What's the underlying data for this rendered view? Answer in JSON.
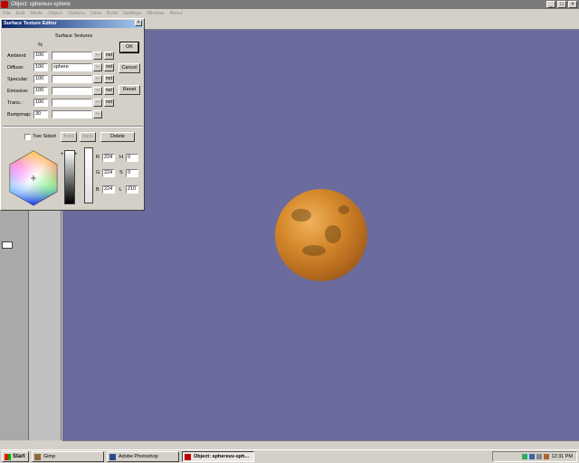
{
  "window": {
    "title": "Object: sphereuv-sphere"
  },
  "menubar": [
    "File",
    "Edit",
    "Mode",
    "Object",
    "Options",
    "View",
    "Build",
    "Settings",
    "Window",
    "About"
  ],
  "window_buttons": {
    "minimize": "_",
    "maximize": "□",
    "close": "×"
  },
  "dialog": {
    "title": "Surface Texture Editor",
    "close_glyph": "×",
    "section_label": "Surface Textures",
    "percent_header": "%",
    "rows": [
      {
        "label": "Ambient:",
        "value": "100",
        "texture": "",
        "browse": "...",
        "md": "md"
      },
      {
        "label": "Diffuse:",
        "value": "100",
        "texture": "sphere",
        "browse": "...",
        "md": "md"
      },
      {
        "label": "Specular:",
        "value": "100",
        "texture": "",
        "browse": "...",
        "md": "md"
      },
      {
        "label": "Emissive:",
        "value": "100",
        "texture": "",
        "browse": "...",
        "md": "md"
      },
      {
        "label": "Trans.:",
        "value": "100",
        "texture": "",
        "browse": "...",
        "md": "md"
      },
      {
        "label": "Bumpmap:",
        "value": "30",
        "texture": "",
        "browse": "...",
        "md": ""
      }
    ],
    "buttons": {
      "ok": "OK",
      "cancel": "Cancel",
      "reset": "Reset"
    },
    "two_sided": {
      "label": "Two Sided",
      "checked": false
    },
    "side_buttons": {
      "front": "front",
      "back": "back",
      "delete": "Delete"
    },
    "color": {
      "r": "224",
      "g": "224",
      "b": "224",
      "h": "0",
      "s": "0",
      "l": "210",
      "labels": {
        "r": "R",
        "g": "G",
        "b": "B",
        "h": "H",
        "s": "S",
        "l": "L"
      }
    }
  },
  "taskbar": {
    "start_label": "Start",
    "tasks": [
      {
        "label": "Gimp",
        "active": false
      },
      {
        "label": "Adobe Photoshop",
        "active": false
      },
      {
        "label": "Object: sphereuv-sph...",
        "active": true
      }
    ],
    "clock": "12:31 PM"
  },
  "colors": {
    "viewport_bg": "#6b6b9e",
    "sphere": "#d68a2c",
    "dialog_title_start": "#0a246a"
  }
}
